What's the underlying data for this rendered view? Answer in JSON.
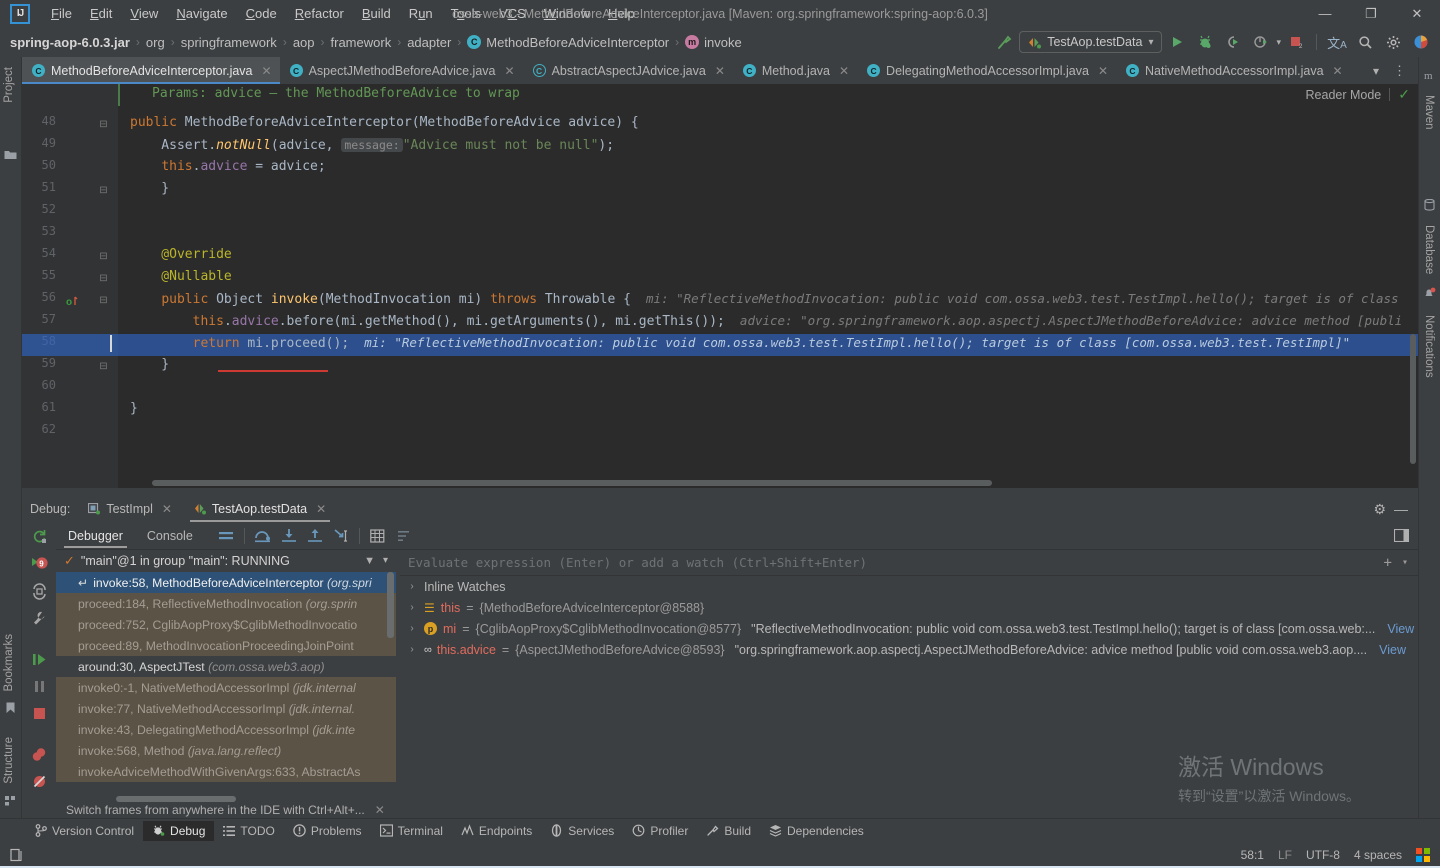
{
  "window": {
    "title": "ossa-web3 - MethodBeforeAdviceInterceptor.java [Maven: org.springframework:spring-aop:6.0.3]",
    "logo_text": "IJ",
    "minimize": "—",
    "maximize": "❐",
    "close": "✕"
  },
  "menubar": {
    "items": [
      {
        "label": "File"
      },
      {
        "label": "Edit"
      },
      {
        "label": "View"
      },
      {
        "label": "Navigate"
      },
      {
        "label": "Code"
      },
      {
        "label": "Refactor"
      },
      {
        "label": "Build"
      },
      {
        "label": "Run"
      },
      {
        "label": "Tools"
      },
      {
        "label": "VCS"
      },
      {
        "label": "Window"
      },
      {
        "label": "Help"
      }
    ]
  },
  "breadcrumb": {
    "items": [
      {
        "label": "spring-aop-6.0.3.jar",
        "icon": "",
        "bold": true
      },
      {
        "label": "org",
        "icon": ""
      },
      {
        "label": "springframework",
        "icon": ""
      },
      {
        "label": "aop",
        "icon": ""
      },
      {
        "label": "framework",
        "icon": ""
      },
      {
        "label": "adapter",
        "icon": ""
      },
      {
        "label": "MethodBeforeAdviceInterceptor",
        "icon": "C"
      },
      {
        "label": "invoke",
        "icon": "m"
      }
    ],
    "separator": "›"
  },
  "run_config": {
    "name": "TestAop.testData",
    "dropdown_arrow": "▾"
  },
  "toolbar_icons": [
    {
      "name": "build-hammer-icon"
    },
    {
      "name": "run-icon"
    },
    {
      "name": "debug-icon"
    },
    {
      "name": "run-with-coverage-icon"
    },
    {
      "name": "profiler-icon"
    },
    {
      "name": "stop-icon"
    },
    {
      "name": "translate-icon"
    },
    {
      "name": "search-icon"
    },
    {
      "name": "settings-gear-icon"
    },
    {
      "name": "account-icon"
    }
  ],
  "left_strip": {
    "items": [
      {
        "label": "Project",
        "icon": "folder-icon"
      },
      {
        "label": "Bookmarks",
        "icon": "bookmark-icon"
      },
      {
        "label": "Structure",
        "icon": "structure-icon"
      }
    ]
  },
  "right_strip": {
    "items": [
      {
        "label": "Maven",
        "icon": "maven-icon"
      },
      {
        "label": "Database",
        "icon": "database-icon"
      },
      {
        "label": "Notifications",
        "icon": "bell-icon"
      }
    ]
  },
  "editor_tabs": [
    {
      "label": "MethodBeforeAdviceInterceptor.java",
      "icon": "C",
      "active": true
    },
    {
      "label": "AspectJMethodBeforeAdvice.java",
      "icon": "C",
      "active": false
    },
    {
      "label": "AbstractAspectJAdvice.java",
      "icon": "C",
      "active": false,
      "outline": true
    },
    {
      "label": "Method.java",
      "icon": "C",
      "active": false
    },
    {
      "label": "DelegatingMethodAccessorImpl.java",
      "icon": "C",
      "active": false
    },
    {
      "label": "NativeMethodAccessorImpl.java",
      "icon": "C",
      "active": false
    }
  ],
  "editor": {
    "reader_mode_label": "Reader Mode",
    "line_numbers": [
      "48",
      "49",
      "50",
      "51",
      "52",
      "53",
      "54",
      "55",
      "56",
      "57",
      "58",
      "59",
      "60",
      "61",
      "62"
    ],
    "doc_line": "Params: advice – the MethodBeforeAdvice to wrap",
    "lines": {
      "l48_kw": "public",
      "l48_rest": " MethodBeforeAdviceInterceptor(MethodBeforeAdvice advice) {",
      "l49_a": "    Assert.",
      "l49_m": "notNull",
      "l49_b": "(advice, ",
      "l49_hint": "message:",
      "l49_str": "\"Advice must not be null\"",
      "l49_c": ");",
      "l50_kw": "this",
      "l50_rest": ".",
      "l50_fld": "advice",
      "l50_rest2": " = advice;",
      "l51": "    }",
      "l54": "    @Override",
      "l55": "    @Nullable",
      "l56_kw": "public",
      "l56_a": " Object ",
      "l56_m": "invoke",
      "l56_b": "(MethodInvocation mi) ",
      "l56_kw2": "throws",
      "l56_c": " Throwable {",
      "l56_hint": "mi: \"ReflectiveMethodInvocation: public void com.ossa.web3.test.TestImpl.hello(); target is of class",
      "l57_kw": "this",
      "l57_a": ".",
      "l57_fld": "advice",
      "l57_b": ".before(mi.getMethod(), mi.getArguments(), mi.getThis());",
      "l57_hint": "advice: \"org.springframework.aop.aspectj.AspectJMethodBeforeAdvice: advice method [publi",
      "l58_kw": "return",
      "l58_rest": " mi.proceed();",
      "l58_hint": "mi: \"ReflectiveMethodInvocation: public void com.ossa.web3.test.TestImpl.hello(); target is of class [com.ossa.web3.test.TestImpl]\"",
      "l59": "    }",
      "l61": "}"
    }
  },
  "debug": {
    "label": "Debug:",
    "sessions": [
      {
        "label": "TestImpl",
        "active": false,
        "icon": "class-run-icon"
      },
      {
        "label": "TestAop.testData",
        "active": true,
        "icon": "junit-icon"
      }
    ],
    "tabs": [
      {
        "label": "Debugger",
        "active": true
      },
      {
        "label": "Console",
        "active": false
      }
    ],
    "toolbar_icons": [
      {
        "name": "layout-settings-icon"
      },
      {
        "name": "step-over-icon"
      },
      {
        "name": "step-into-icon"
      },
      {
        "name": "step-out-icon"
      },
      {
        "name": "run-to-cursor-icon"
      },
      {
        "name": "evaluate-table-icon"
      },
      {
        "name": "sort-icon"
      }
    ],
    "rail_icons": [
      {
        "name": "rerun-icon"
      },
      {
        "name": "view-breakpoints-icon"
      },
      {
        "name": "restore-layout-icon"
      },
      {
        "name": "settings-wrench-icon"
      },
      {
        "name": "resume-program-icon"
      },
      {
        "name": "pause-program-icon"
      },
      {
        "name": "stop-program-icon"
      },
      {
        "name": "mute-breakpoints-icon"
      },
      {
        "name": "no-breakpoints-icon"
      },
      {
        "name": "more-icon"
      }
    ],
    "thread": "\"main\"@1 in group \"main\": RUNNING",
    "frames": [
      {
        "method": "invoke:58, MethodBeforeAdviceInterceptor",
        "pkg": "(org.spri",
        "state": "sel"
      },
      {
        "method": "proceed:184, ReflectiveMethodInvocation",
        "pkg": "(org.sprin",
        "state": "lib"
      },
      {
        "method": "proceed:752, CglibAopProxy$CglibMethodInvocatio",
        "pkg": "",
        "state": "lib"
      },
      {
        "method": "proceed:89, MethodInvocationProceedingJoinPoint",
        "pkg": "",
        "state": "lib"
      },
      {
        "method": "around:30, AspectJTest",
        "pkg": "(com.ossa.web3.aop)",
        "state": "own"
      },
      {
        "method": "invoke0:-1, NativeMethodAccessorImpl",
        "pkg": "(jdk.internal",
        "state": "lib"
      },
      {
        "method": "invoke:77, NativeMethodAccessorImpl",
        "pkg": "(jdk.internal.",
        "state": "lib"
      },
      {
        "method": "invoke:43, DelegatingMethodAccessorImpl",
        "pkg": "(jdk.inte",
        "state": "lib"
      },
      {
        "method": "invoke:568, Method",
        "pkg": "(java.lang.reflect)",
        "state": "lib"
      },
      {
        "method": "invokeAdviceMethodWithGivenArgs:633, AbstractAs",
        "pkg": "",
        "state": "lib"
      }
    ],
    "frames_hint": "Switch frames from anywhere in the IDE with Ctrl+Alt+...",
    "evaluate_placeholder": "Evaluate expression (Enter) or add a watch (Ctrl+Shift+Enter)",
    "variables": [
      {
        "chev": "›",
        "icon": "none",
        "name": "Inline Watches",
        "eq": "",
        "value": "",
        "str": "",
        "link": ""
      },
      {
        "chev": "›",
        "icon": "this",
        "name": "this",
        "eq": " = ",
        "value": "{MethodBeforeAdviceInterceptor@8588}",
        "str": "",
        "link": ""
      },
      {
        "chev": "›",
        "icon": "param",
        "name": "mi",
        "eq": " = ",
        "value": "{CglibAopProxy$CglibMethodInvocation@8577}",
        "str": "\"ReflectiveMethodInvocation: public void com.ossa.web3.test.TestImpl.hello(); target is of class [com.ossa.web:...",
        "link": "View"
      },
      {
        "chev": "›",
        "icon": "field",
        "name": "this.advice",
        "eq": " = ",
        "value": "{AspectJMethodBeforeAdvice@8593}",
        "str": "\"org.springframework.aop.aspectj.AspectJMethodBeforeAdvice: advice method [public void com.ossa.web3.aop....",
        "link": "View"
      }
    ]
  },
  "watermark": {
    "line1": "激活 Windows",
    "line2": "转到“设置”以激活 Windows。"
  },
  "bottom_bar": {
    "items": [
      {
        "label": "Version Control",
        "icon": "branch-icon",
        "active": false
      },
      {
        "label": "Debug",
        "icon": "debug-icon",
        "active": true
      },
      {
        "label": "TODO",
        "icon": "todo-icon",
        "active": false
      },
      {
        "label": "Problems",
        "icon": "problems-icon",
        "active": false
      },
      {
        "label": "Terminal",
        "icon": "terminal-icon",
        "active": false
      },
      {
        "label": "Endpoints",
        "icon": "endpoints-icon",
        "active": false
      },
      {
        "label": "Services",
        "icon": "services-icon",
        "active": false
      },
      {
        "label": "Profiler",
        "icon": "profiler-icon",
        "active": false
      },
      {
        "label": "Build",
        "icon": "build-icon",
        "active": false
      },
      {
        "label": "Dependencies",
        "icon": "dependencies-icon",
        "active": false
      }
    ]
  },
  "status_bar": {
    "caret_position": "58:1",
    "line_separator": "LF",
    "encoding": "UTF-8",
    "indent": "4 spaces",
    "colors": {
      "accent_blue": "#4a88c7",
      "selection_blue": "#2f65ca",
      "keyword_orange": "#cc7832",
      "string_green": "#6a8759",
      "error_red": "#cc3a33"
    }
  }
}
